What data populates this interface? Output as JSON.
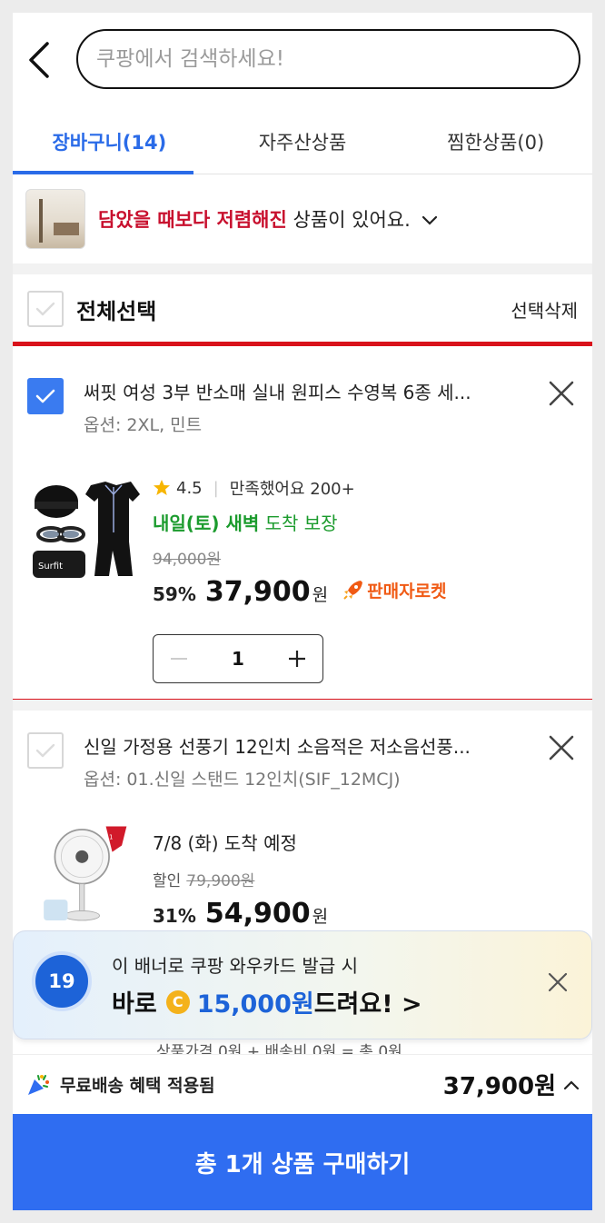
{
  "header": {
    "search_placeholder": "쿠팡에서 검색하세요!"
  },
  "tabs": [
    {
      "label": "장바구니(14)",
      "active": true
    },
    {
      "label": "자주산상품",
      "active": false
    },
    {
      "label": "찜한상품(0)",
      "active": false
    }
  ],
  "notice": {
    "highlight": "담았을 때보다 저렴해진",
    "rest": " 상품이 있어요."
  },
  "select_all": {
    "label": "전체선택",
    "delete_label": "선택삭제"
  },
  "items": [
    {
      "checked": true,
      "title": "써핏 여성 3부 반소매 실내 원피스 수영복 6종 세...",
      "option": "옵션: 2XL, 민트",
      "rating": "4.5",
      "review_text": "만족했어요 200+",
      "delivery_bold": "내일(토) 새벽",
      "delivery_rest": " 도착 보장",
      "original_price": "94,000원",
      "discount": "59%",
      "price": "37,900",
      "won": "원",
      "badge": "판매자로켓",
      "quantity": "1"
    },
    {
      "checked": false,
      "title": "신일 가정용 선풍기 12인치 소음적은 저소음선풍...",
      "option": "옵션: 01.신일 스탠드 12인치(SIF_12MCJ)",
      "delivery_date": "7/8 (화) 도착 예정",
      "discount_label": "할인",
      "original_price": "79,900원",
      "discount": "31%",
      "price": "54,900",
      "won": "원"
    }
  ],
  "banner": {
    "timer": "19",
    "top_text": "이 배너로 쿠팡 와우카드 발급 시",
    "prefix": "바로",
    "coin": "C",
    "amount": "15,000원",
    "suffix": " 드려요! >"
  },
  "summary_peek": "상품가격  0원 + 배송비  0원 = 총 0원",
  "footer": {
    "free_shipping": "무료배송 혜택 적용됨",
    "total": "37,900원",
    "buy_label": "총 1개 상품 구매하기"
  },
  "colors": {
    "accent": "#2f6df1",
    "tab_active": "#2a6be8",
    "highlight_border": "#d9121b",
    "delivery_green": "#1b9b2d",
    "rocket_orange": "#f05a14"
  }
}
